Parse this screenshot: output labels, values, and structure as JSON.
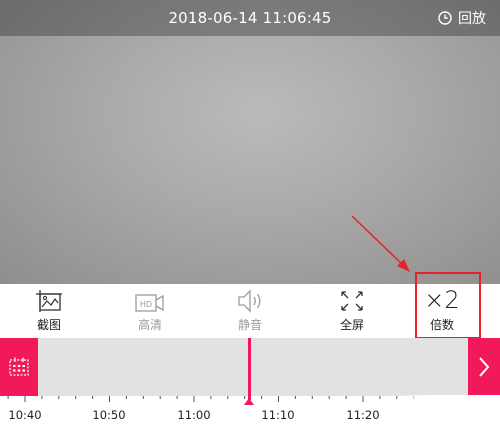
{
  "header": {
    "datetime": "2018-06-14 11:06:45",
    "playback_label": "回放"
  },
  "toolbar": {
    "items": [
      {
        "id": "screenshot",
        "label": "截图",
        "icon": "screenshot-icon"
      },
      {
        "id": "hd",
        "label": "高清",
        "icon": "hd-video-icon"
      },
      {
        "id": "mute",
        "label": "静音",
        "icon": "speaker-icon"
      },
      {
        "id": "fullscreen",
        "label": "全屏",
        "icon": "fullscreen-icon"
      },
      {
        "id": "zoom",
        "label": "倍数",
        "value": "×2"
      }
    ]
  },
  "timeline": {
    "ticks": [
      "10:40",
      "10:50",
      "11:00",
      "11:10",
      "11:20"
    ]
  },
  "colors": {
    "accent": "#f2195a",
    "annotation": "#e8202a"
  }
}
